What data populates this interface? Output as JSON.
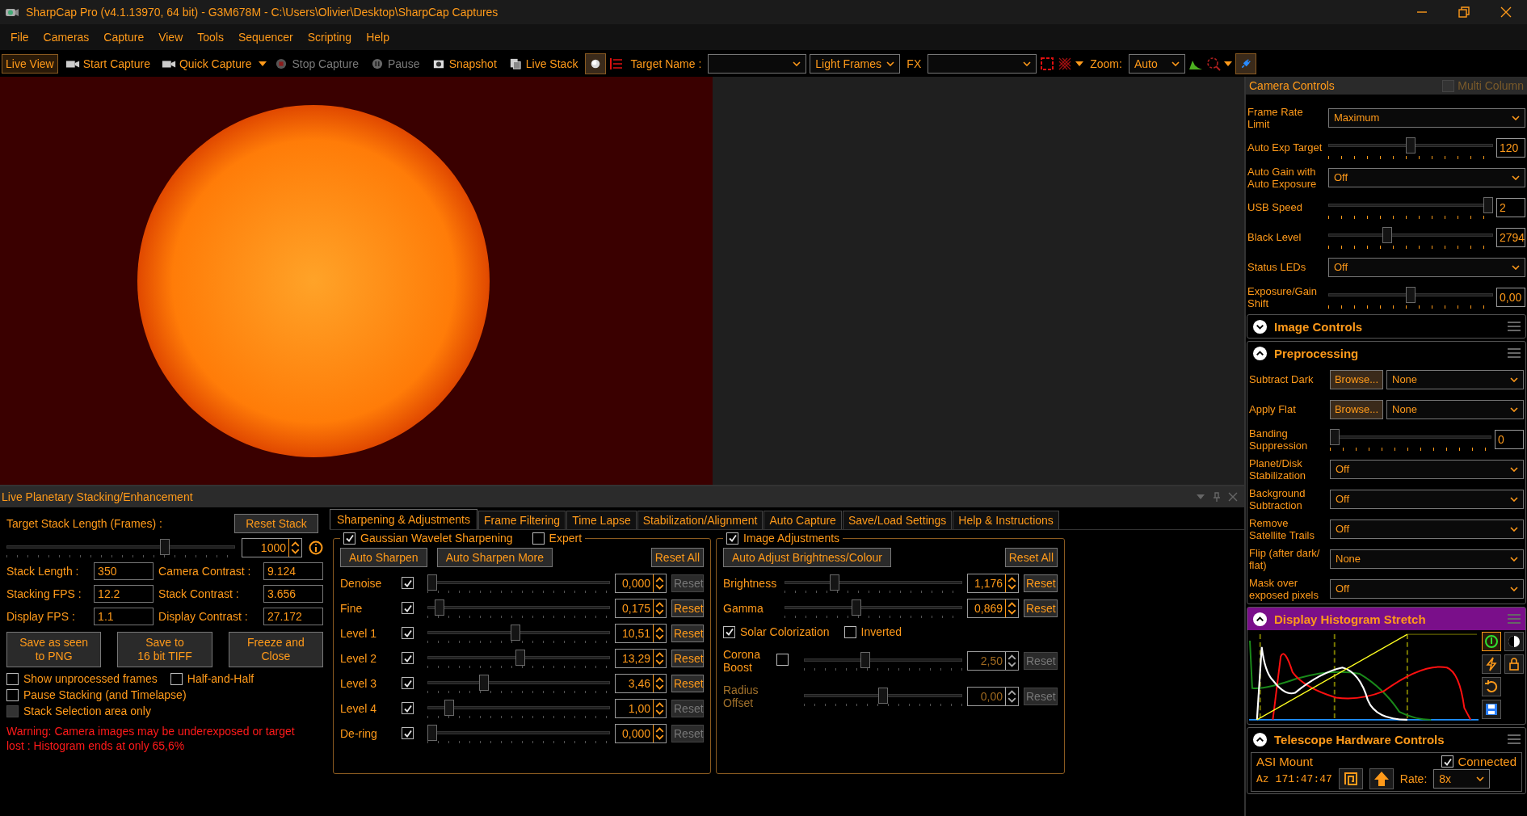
{
  "window": {
    "title": "SharpCap Pro (v4.1.13970, 64 bit) - G3M678M - C:\\Users\\Olivier\\Desktop\\SharpCap Captures"
  },
  "menu": [
    "File",
    "Cameras",
    "Capture",
    "View",
    "Tools",
    "Sequencer",
    "Scripting",
    "Help"
  ],
  "toolbar": {
    "buttons": [
      {
        "label": "Live View",
        "selected": true,
        "disabled": false
      },
      {
        "label": "Start Capture",
        "selected": false,
        "disabled": false
      },
      {
        "label": "Quick Capture",
        "selected": false,
        "disabled": false
      },
      {
        "label": "Stop Capture",
        "selected": false,
        "disabled": true
      },
      {
        "label": "Pause",
        "selected": false,
        "disabled": true
      },
      {
        "label": "Snapshot",
        "selected": false,
        "disabled": false
      },
      {
        "label": "Live Stack",
        "selected": false,
        "disabled": false
      }
    ],
    "target_name": {
      "label": "Target Name :"
    },
    "frame_type": {
      "value": "Light Frames"
    },
    "fx": {
      "label": "FX"
    },
    "zoom": {
      "label": "Zoom:",
      "value": "Auto"
    }
  },
  "stacking": {
    "title": "Live Planetary Stacking/Enhancement",
    "target": {
      "label": "Target Stack Length (Frames) :",
      "reset": "Reset Stack",
      "level": 0.7,
      "value": "1000"
    },
    "stats": [
      {
        "label": "Stack Length :",
        "value": "350"
      },
      {
        "label": "Camera Contrast :",
        "value": "9.124"
      },
      {
        "label": "Stacking FPS :",
        "value": "12.2"
      },
      {
        "label": "Stack Contrast :",
        "value": "3.656"
      },
      {
        "label": "Display FPS :",
        "value": "1.1"
      },
      {
        "label": "Display Contrast :",
        "value": "27.172"
      }
    ],
    "actions": [
      {
        "lines": [
          "Save as seen",
          "to PNG"
        ]
      },
      {
        "lines": [
          "Save to",
          "16 bit TIFF"
        ]
      },
      {
        "lines": [
          "Freeze and",
          "Close"
        ]
      }
    ],
    "option_rows": [
      {
        "items": [
          {
            "label": "Show unprocessed frames",
            "checked": false,
            "disabled": false
          },
          {
            "label": "Half-and-Half",
            "checked": false,
            "disabled": false
          }
        ]
      },
      {
        "items": [
          {
            "label": "Pause Stacking (and Timelapse)",
            "checked": false,
            "disabled": false
          }
        ]
      },
      {
        "items": [
          {
            "label": "Stack Selection area only",
            "checked": false,
            "disabled": true
          }
        ]
      }
    ],
    "warning": "Warning: Camera images may be underexposed or target lost : Histogram ends at only 65,6%",
    "tabs": [
      {
        "label": "Sharpening & Adjustments",
        "selected": true
      },
      {
        "label": "Frame Filtering",
        "selected": false
      },
      {
        "label": "Time Lapse",
        "selected": false
      },
      {
        "label": "Stabilization/Alignment",
        "selected": false
      },
      {
        "label": "Auto Capture",
        "selected": false
      },
      {
        "label": "Save/Load Settings",
        "selected": false
      },
      {
        "label": "Help & Instructions",
        "selected": false
      }
    ],
    "sharpening": {
      "title": "Gaussian Wavelet Sharpening",
      "checked": true,
      "expert": {
        "label": "Expert",
        "checked": false
      },
      "buttons": [
        "Auto Sharpen",
        "Auto Sharpen More"
      ],
      "reset_all": "Reset All",
      "rows": [
        {
          "label": "Denoise",
          "checked": true,
          "level": 0,
          "value": "0,000",
          "reset": "Reset",
          "reset_disabled": true
        },
        {
          "label": "Fine",
          "checked": true,
          "level": 0.04,
          "value": "0,175",
          "reset": "Reset",
          "reset_disabled": false
        },
        {
          "label": "Level 1",
          "checked": true,
          "level": 0.48,
          "value": "10,51",
          "reset": "Reset",
          "reset_disabled": false
        },
        {
          "label": "Level 2",
          "checked": true,
          "level": 0.51,
          "value": "13,29",
          "reset": "Reset",
          "reset_disabled": false
        },
        {
          "label": "Level 3",
          "checked": true,
          "level": 0.3,
          "value": "3,46",
          "reset": "Reset",
          "reset_disabled": false
        },
        {
          "label": "Level 4",
          "checked": true,
          "level": 0.1,
          "value": "1,00",
          "reset": "Reset",
          "reset_disabled": true
        },
        {
          "label": "De-ring",
          "checked": true,
          "level": 0,
          "value": "0,000",
          "reset": "Reset",
          "reset_disabled": true
        }
      ]
    },
    "adjustments": {
      "title": "Image Adjustments",
      "checked": true,
      "button": "Auto Adjust Brightness/Colour",
      "reset_all": "Reset All",
      "upper_rows": [
        {
          "label": "Brightness",
          "level": 0.27,
          "value": "1,176",
          "reset": "Reset",
          "disabled": false
        },
        {
          "label": "Gamma",
          "level": 0.4,
          "value": "0,869",
          "reset": "Reset",
          "disabled": false
        }
      ],
      "colorization": {
        "label": "Solar Colorization",
        "checked": true
      },
      "inverted": {
        "label": "Inverted",
        "checked": false
      },
      "lower_rows": [
        {
          "kind": "check-slider",
          "label": "Corona Boost",
          "checked": false,
          "level": 0.38,
          "value": "2,50",
          "reset": "Reset",
          "disabled": true,
          "label_dim": false
        },
        {
          "kind": "slider",
          "label": "Radius Offset",
          "level": 0.5,
          "value": "0,00",
          "reset": "Reset",
          "disabled": true,
          "label_dim": true
        }
      ]
    }
  },
  "camera_controls": {
    "title": "Camera Controls",
    "multi_column": {
      "label": "Multi Column",
      "checked": false,
      "disabled": true
    },
    "rows": [
      {
        "kind": "dropdown",
        "label": "Frame Rate Limit",
        "value": "Maximum"
      },
      {
        "kind": "slider",
        "label": "Auto Exp Target",
        "level": 0.5,
        "value": "120"
      },
      {
        "kind": "dropdown",
        "label": "Auto Gain with Auto Exposure",
        "value": "Off"
      },
      {
        "kind": "slider",
        "label": "USB Speed",
        "level": 1,
        "value": "2"
      },
      {
        "kind": "slider",
        "label": "Black Level",
        "level": 0.35,
        "value": "2794"
      },
      {
        "kind": "dropdown",
        "label": "Status LEDs",
        "value": "Off"
      },
      {
        "kind": "slider",
        "label": "Exposure/Gain Shift",
        "level": 0.5,
        "value": "0,00"
      }
    ]
  },
  "image_controls": {
    "title": "Image Controls",
    "expanded": false
  },
  "preprocessing": {
    "title": "Preprocessing",
    "expanded": true,
    "rows": [
      {
        "kind": "file",
        "label": "Subtract Dark",
        "button": "Browse...",
        "value": "None"
      },
      {
        "kind": "file",
        "label": "Apply Flat",
        "button": "Browse...",
        "value": "None"
      },
      {
        "kind": "slider",
        "label": "Banding Suppression",
        "level": 0,
        "value": "0"
      },
      {
        "kind": "dropdown",
        "label": "Planet/Disk Stabilization",
        "value": "Off"
      },
      {
        "kind": "dropdown",
        "label": "Background Subtraction",
        "value": "Off"
      },
      {
        "kind": "dropdown",
        "label": "Remove Satellite Trails",
        "value": "Off"
      },
      {
        "kind": "dropdown",
        "label": "Flip (after dark/ flat)",
        "value": "None"
      },
      {
        "kind": "dropdown",
        "label": "Mask over exposed pixels",
        "value": "Off"
      }
    ]
  },
  "histogram": {
    "title": "Display Histogram Stretch",
    "expanded": true,
    "highlighted": true,
    "power_on": true
  },
  "telescope": {
    "title": "Telescope Hardware Controls",
    "expanded": true,
    "device": "ASI Mount",
    "connected": {
      "label": "Connected",
      "checked": true
    },
    "axis": "Az",
    "position": "171:47:47",
    "rate": {
      "label": "Rate:",
      "value": "8x"
    }
  }
}
